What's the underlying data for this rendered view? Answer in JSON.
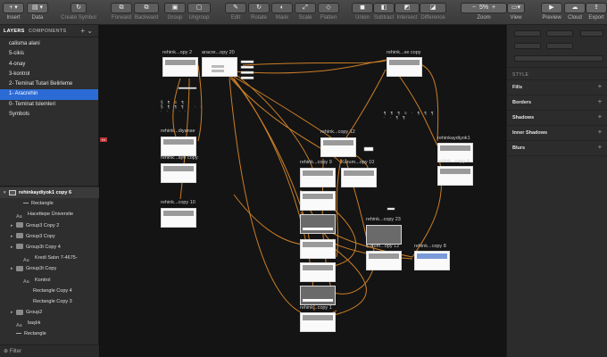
{
  "toolbar": {
    "insert": "Insert",
    "data": "Data",
    "create_symbol": "Create Symbol",
    "forward": "Forward",
    "backward": "Backward",
    "group": "Group",
    "ungroup": "Ungroup",
    "edit": "Edit",
    "rotate": "Rotate",
    "mask": "Mask",
    "scale": "Scale",
    "flatten": "Flatten",
    "union": "Union",
    "subtract": "Subtract",
    "intersect": "Intersect",
    "difference": "Difference",
    "zoom_label": "Zoom",
    "zoom_value": "5%",
    "zoom_minus": "−",
    "zoom_plus": "+",
    "view": "View",
    "preview": "Preview",
    "cloud": "Cloud",
    "export": "Export"
  },
  "sidebar": {
    "tabs": [
      "LAYERS",
      "COMPONENTS"
    ],
    "pages": [
      {
        "label": "calisma alani",
        "selected": false
      },
      {
        "label": "5-cikis",
        "selected": false
      },
      {
        "label": "4-onay",
        "selected": false
      },
      {
        "label": "3-kontrol",
        "selected": false
      },
      {
        "label": "2- Teminat Tutari Belirleme",
        "selected": false
      },
      {
        "label": "1- Aracrehin",
        "selected": true
      },
      {
        "label": "0- Teminat Islemleri",
        "selected": false
      },
      {
        "label": "Symbols",
        "selected": false
      }
    ],
    "layers": [
      {
        "label": "rehinkaydiyok1 copy 6",
        "icon": "artboard-icon",
        "indent": 0,
        "arrow": true
      },
      {
        "label": "Rectangle",
        "icon": "line-icon",
        "indent": 2,
        "arrow": false
      },
      {
        "label": "Hacettepe Üniversite",
        "icon": "text-icon",
        "indent": 1,
        "arrow": false
      },
      {
        "label": "Group3 Copy 2",
        "icon": "folder-icon",
        "indent": 1,
        "arrow": true
      },
      {
        "label": "Group3 Copy",
        "icon": "folder-icon",
        "indent": 1,
        "arrow": true
      },
      {
        "label": "Group3t Copy 4",
        "icon": "folder-icon",
        "indent": 1,
        "arrow": true
      },
      {
        "label": "Kredi Satın 7-4675-",
        "icon": "text-icon",
        "indent": 2,
        "arrow": false
      },
      {
        "label": "Group3t Copy",
        "icon": "folder-icon",
        "indent": 1,
        "arrow": true
      },
      {
        "label": "Kontrol",
        "icon": "text-icon",
        "indent": 2,
        "arrow": false
      },
      {
        "label": "Rectangle Copy 4",
        "icon": "none",
        "indent": 2,
        "arrow": false
      },
      {
        "label": "Rectangle Copy 3",
        "icon": "none",
        "indent": 2,
        "arrow": false
      },
      {
        "label": "Group2",
        "icon": "folder-icon",
        "indent": 1,
        "arrow": true
      },
      {
        "label": "başlık",
        "icon": "text-icon",
        "indent": 1,
        "arrow": false
      },
      {
        "label": "Rectangle",
        "icon": "line-icon",
        "indent": 1,
        "arrow": false
      }
    ],
    "filter": "Filter"
  },
  "canvas": {
    "artboards": [
      {
        "label": "rehink...opy 2"
      },
      {
        "label": "aracre...opy 20"
      },
      {
        "label": "rehink...se copy"
      },
      {
        "label": "rehink...diyanse"
      },
      {
        "label": "rehink...aye copy"
      },
      {
        "label": "rehink...copy 10"
      },
      {
        "label": "rehink...copy 12"
      },
      {
        "label": "rehink...copy 9"
      },
      {
        "label": "Kurum...opy 10"
      },
      {
        "label": "rehinkaydiyok1"
      },
      {
        "label": "rehink...copy 4"
      },
      {
        "label": "rehink...copy 23"
      },
      {
        "label": "Kurum...opy 12"
      },
      {
        "label": "rehink...copy 8"
      },
      {
        "label": "rehink...copy 1"
      }
    ]
  },
  "inspector": {
    "style_header": "STYLE",
    "sections": [
      "Fills",
      "Borders",
      "Shadows",
      "Inner Shadows",
      "Blurs"
    ],
    "add": "+"
  },
  "colors": {
    "accent": "#2c6ad6",
    "wire": "#e08a2a"
  }
}
